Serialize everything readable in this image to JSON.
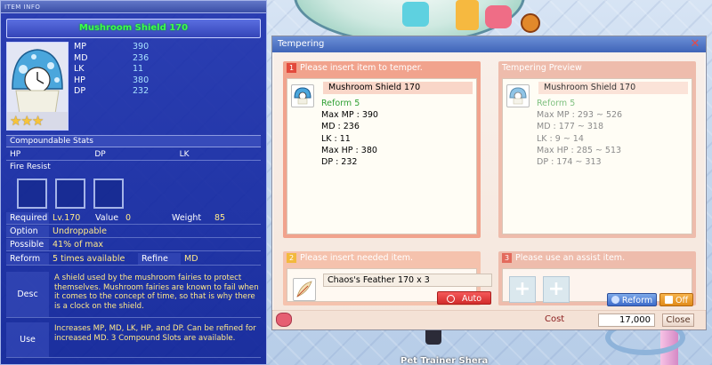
{
  "item_info": {
    "title_small": "ITEM INFO",
    "item_name": "Mushroom Shield 170",
    "stats": [
      {
        "k": "MP",
        "v": "390"
      },
      {
        "k": "MD",
        "v": "236"
      },
      {
        "k": "LK",
        "v": "11"
      },
      {
        "k": "HP",
        "v": "380"
      },
      {
        "k": "DP",
        "v": "232"
      }
    ],
    "stars": "★★★",
    "compoundable_header": "Compoundable Stats",
    "compound_cols": [
      "HP",
      "DP",
      "LK"
    ],
    "fire_resist": "Fire Resist",
    "required_label": "Required",
    "required_val": "Lv.170",
    "value_label": "Value",
    "value_val": "0",
    "weight_label": "Weight",
    "weight_val": "85",
    "option_label": "Option",
    "option_val": "Undroppable",
    "possible_label": "Possible",
    "possible_val": "41% of max",
    "reform_label": "Reform",
    "reform_val": "5 times available",
    "refine_label": "Refine",
    "refine_val": "MD",
    "desc_label": "Desc",
    "desc_val": "A shield used by the mushroom fairies to protect themselves. Mushroom fairies are known to fail when it comes to the concept of time, so that is why there is a clock on the shield.",
    "use_label": "Use",
    "use_val": "Increases MP, MD, LK, HP, and DP. Can be refined for increased MD. 3 Compound Slots are available."
  },
  "tempering": {
    "title": "Tempering",
    "step1_num": "1",
    "step1_label": "Please insert item to temper.",
    "preview_label": "Tempering Preview",
    "item_name": "Mushroom Shield 170",
    "current": {
      "reform": "Reform 5",
      "lines": [
        "Max MP : 390",
        "MD : 236",
        "LK : 11",
        "Max HP : 380",
        "DP : 232"
      ]
    },
    "preview": {
      "reform": "Reform 5",
      "lines": [
        "Max MP : 293 ~ 526",
        "MD : 177 ~ 318",
        "LK : 9 ~ 14",
        "Max HP : 285 ~ 513",
        "DP : 174 ~ 313"
      ]
    },
    "step2_num": "2",
    "step2_label": "Please insert needed item.",
    "needed_item": "Chaos's Feather 170 x 3",
    "auto_label": "Auto",
    "step3_num": "3",
    "step3_label": "Please use an assist item.",
    "reform_btn": "Reform",
    "off_btn": "Off",
    "cost_label": "Cost",
    "cost_val": "17,000",
    "close_btn": "Close"
  },
  "background": {
    "npc_name": "Pet Trainer Shera"
  }
}
